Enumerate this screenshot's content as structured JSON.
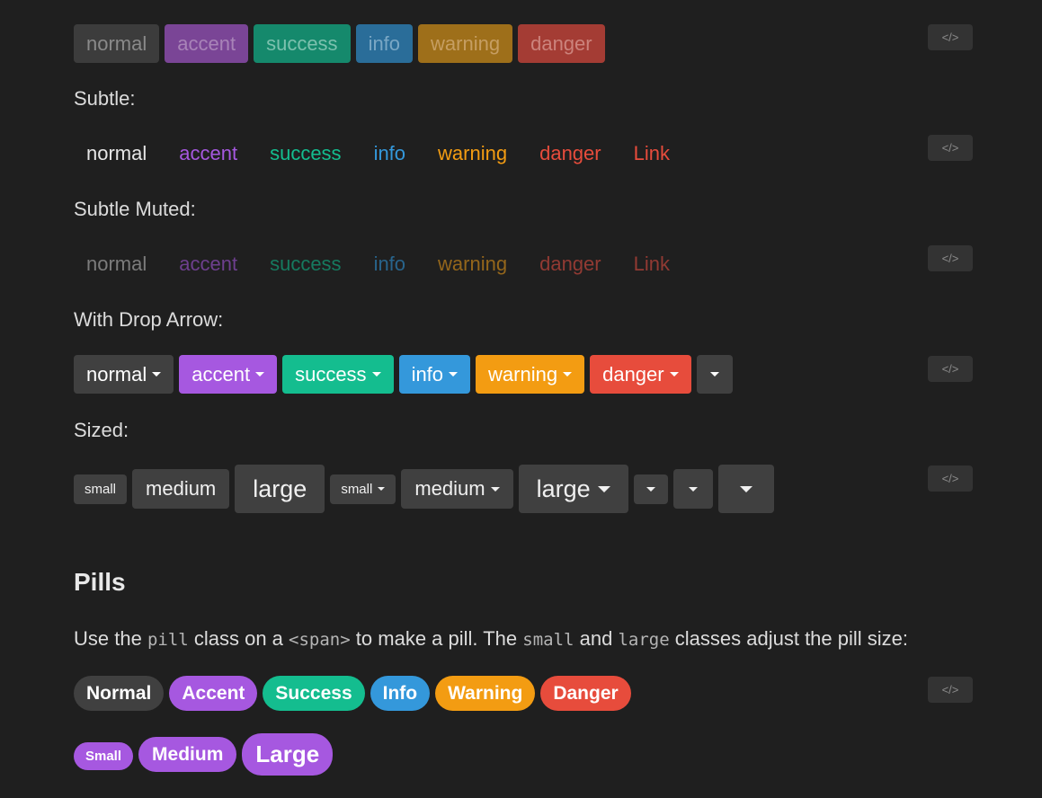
{
  "code_toggle_label": "</>",
  "row1": {
    "buttons": [
      "normal",
      "accent",
      "success",
      "info",
      "warning",
      "danger"
    ]
  },
  "subtle": {
    "label": "Subtle:",
    "buttons": [
      "normal",
      "accent",
      "success",
      "info",
      "warning",
      "danger",
      "Link"
    ]
  },
  "subtle_muted": {
    "label": "Subtle Muted:",
    "buttons": [
      "normal",
      "accent",
      "success",
      "info",
      "warning",
      "danger",
      "Link"
    ]
  },
  "drop_arrow": {
    "label": "With Drop Arrow:",
    "buttons": [
      "normal",
      "accent",
      "success",
      "info",
      "warning",
      "danger"
    ]
  },
  "sized": {
    "label": "Sized:",
    "buttons": [
      "small",
      "medium",
      "large",
      "small",
      "medium",
      "large"
    ]
  },
  "pills": {
    "heading": "Pills",
    "desc_1": "Use the",
    "code_1": "pill",
    "desc_2": "class on a",
    "code_2": "<span>",
    "desc_3": "to make a pill. The",
    "code_3": "small",
    "desc_4": "and",
    "code_4": "large",
    "desc_5": "classes adjust the pill size:",
    "items": [
      "Normal",
      "Accent",
      "Success",
      "Info",
      "Warning",
      "Danger"
    ],
    "sized": [
      "Small",
      "Medium",
      "Large"
    ]
  },
  "colors": {
    "accent": "#a658e0",
    "success": "#14bd8f",
    "info": "#3498db",
    "warning": "#f39c12",
    "danger": "#e74c3c",
    "background": "#1f1f1f"
  }
}
